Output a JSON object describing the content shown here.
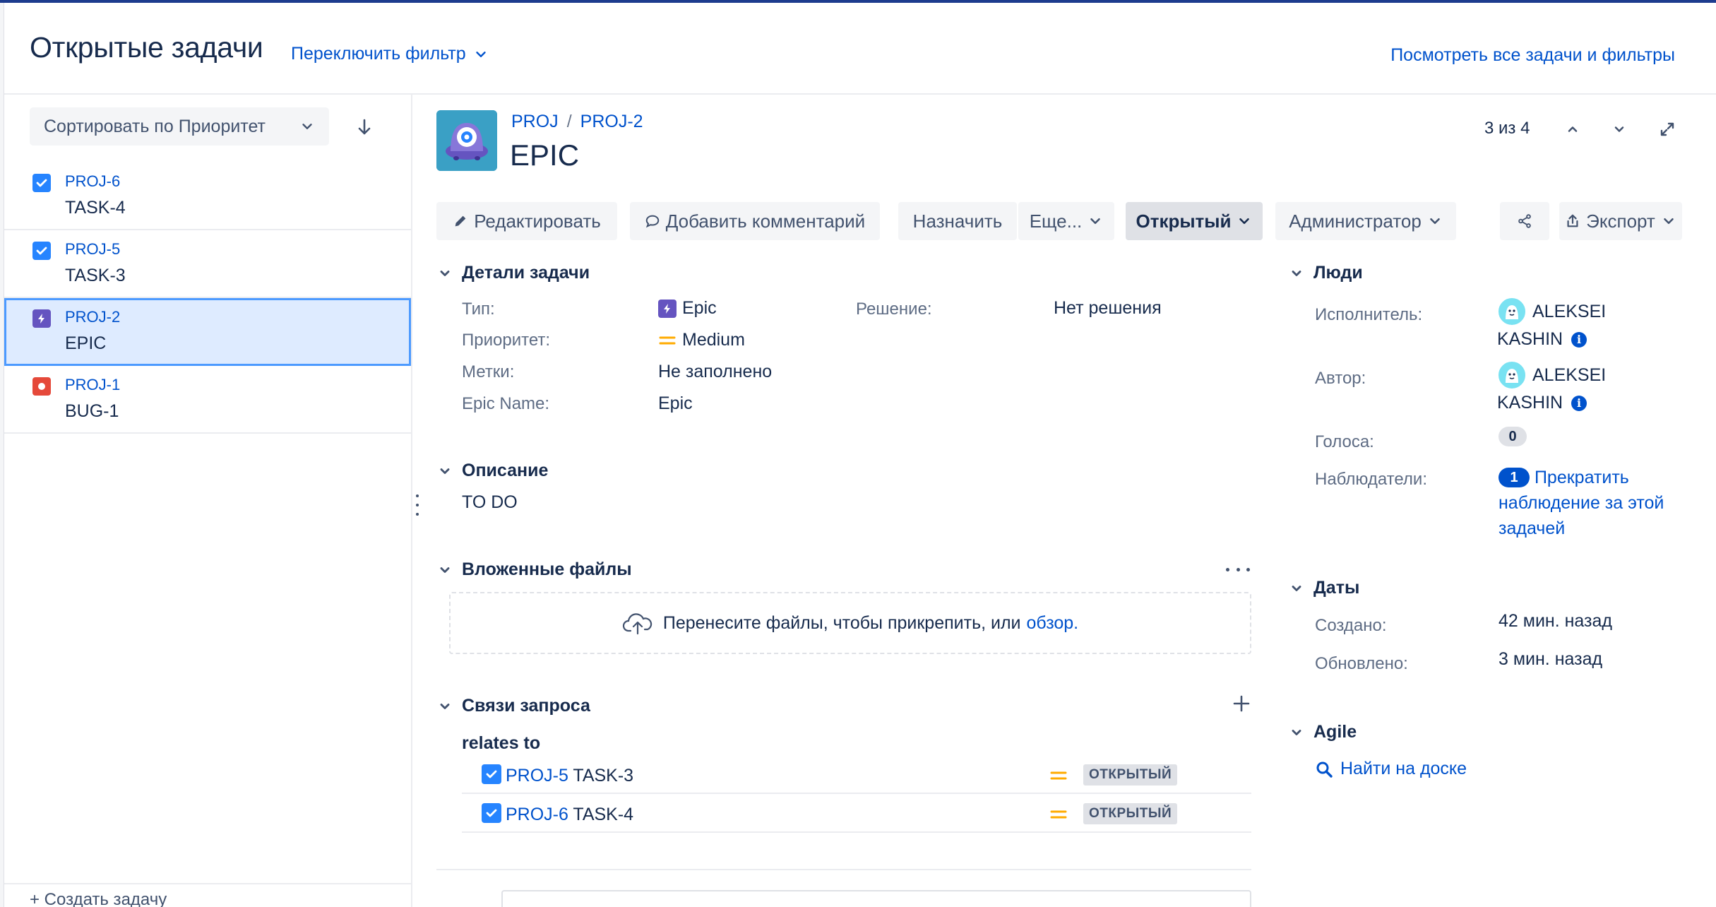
{
  "header": {
    "title": "Открытые задачи",
    "switch_filter": "Переключить фильтр",
    "view_all": "Посмотреть все задачи и фильтры"
  },
  "sidebar": {
    "sort_label": "Сортировать по Приоритет",
    "items": [
      {
        "key": "PROJ-6",
        "summary": "TASK-4",
        "type": "task"
      },
      {
        "key": "PROJ-5",
        "summary": "TASK-3",
        "type": "task"
      },
      {
        "key": "PROJ-2",
        "summary": "EPIC",
        "type": "epic"
      },
      {
        "key": "PROJ-1",
        "summary": "BUG-1",
        "type": "bug"
      }
    ],
    "create_label": "+ Создать задачу"
  },
  "issue": {
    "breadcrumb_project": "PROJ",
    "breadcrumb_sep": "/",
    "breadcrumb_key": "PROJ-2",
    "title": "EPIC",
    "pager": "3 из 4"
  },
  "toolbar": {
    "edit": "Редактировать",
    "comment": "Добавить комментарий",
    "assign": "Назначить",
    "more": "Еще...",
    "status": "Открытый",
    "admin": "Администратор",
    "export": "Экспорт"
  },
  "details": {
    "heading": "Детали задачи",
    "type_label": "Тип:",
    "type_value": "Epic",
    "priority_label": "Приоритет:",
    "priority_value": "Medium",
    "labels_label": "Метки:",
    "labels_value": "Не заполнено",
    "epic_name_label": "Epic Name:",
    "epic_name_value": "Epic",
    "resolution_label": "Решение:",
    "resolution_value": "Нет решения"
  },
  "description": {
    "heading": "Описание",
    "text": "TO DO"
  },
  "attachments": {
    "heading": "Вложенные файлы",
    "drop_text": "Перенесите файлы, чтобы прикрепить, или",
    "browse_link": "обзор."
  },
  "links": {
    "heading": "Связи запроса",
    "relation": "relates to",
    "items": [
      {
        "key": "PROJ-5",
        "summary": "TASK-3",
        "status": "ОТКРЫТЫЙ"
      },
      {
        "key": "PROJ-6",
        "summary": "TASK-4",
        "status": "ОТКРЫТЫЙ"
      }
    ]
  },
  "people": {
    "heading": "Люди",
    "assignee_label": "Исполнитель:",
    "assignee_first": "ALEKSEI",
    "assignee_last": "KASHIN",
    "reporter_label": "Автор:",
    "reporter_first": "ALEKSEI",
    "reporter_last": "KASHIN",
    "votes_label": "Голоса:",
    "votes_count": "0",
    "watchers_label": "Наблюдатели:",
    "watchers_count": "1",
    "watch_line1": "Прекратить",
    "watch_line2": "наблюдение за этой",
    "watch_line3": "задачей"
  },
  "dates": {
    "heading": "Даты",
    "created_label": "Создано:",
    "created_value": "42 мин. назад",
    "updated_label": "Обновлено:",
    "updated_value": "3 мин. назад"
  },
  "agile": {
    "heading": "Agile",
    "find_on_board": "Найти на доске"
  },
  "colors": {
    "accent": "#0052cc",
    "brand_bar": "#1d3c8e",
    "task_blue": "#2684ff",
    "epic_purple": "#6554c0",
    "bug_red": "#e5493a",
    "priority_medium": "#ffab00"
  }
}
